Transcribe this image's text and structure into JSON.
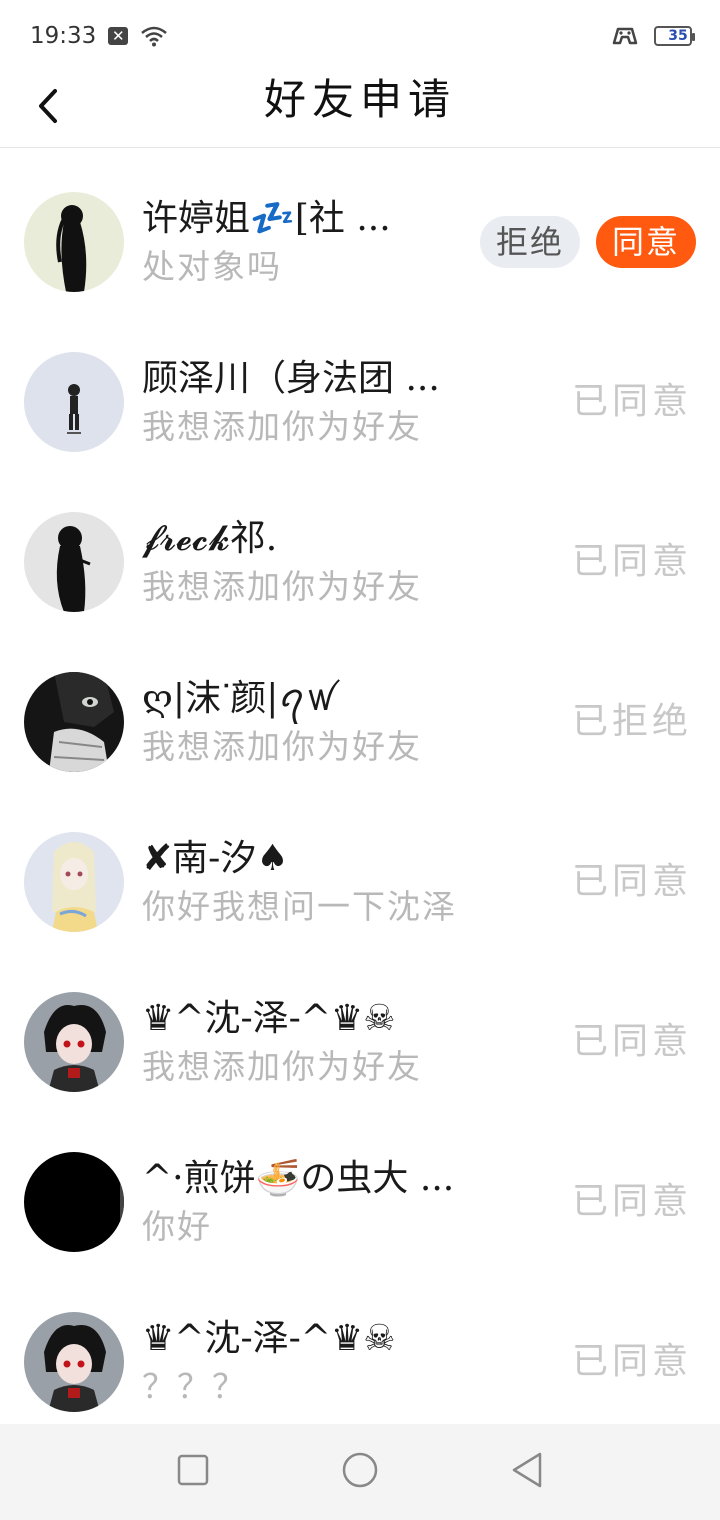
{
  "status_bar": {
    "time": "19:33",
    "battery": "35",
    "battery_level": 0.35,
    "icons": [
      "notification-icon",
      "wifi-icon",
      "game-icon",
      "battery-icon"
    ]
  },
  "header": {
    "title": "好友申请",
    "back_icon": "chevron-left-icon"
  },
  "requests": [
    {
      "name": "许婷姐💤[社 ...",
      "message": "处对象吗",
      "state": "pending",
      "reject_label": "拒绝",
      "accept_label": "同意",
      "avatar": "silhouette-girl"
    },
    {
      "name": "顾泽川（身法团 ...",
      "message": "我想添加你为好友",
      "state": "已同意",
      "avatar": "small-figure"
    },
    {
      "name": "𝓯𝓻𝓮𝓬𝓴祁.",
      "message": "我想添加你为好友",
      "state": "已同意",
      "avatar": "silhouette-dress"
    },
    {
      "name": "ღ|沫ᐝ颜|ꪖꪝ",
      "message": "我想添加你为好友",
      "state": "已拒绝",
      "avatar": "dark-anime"
    },
    {
      "name": "✘南-汐♠",
      "message": "你好我想问一下沈泽",
      "state": "已同意",
      "avatar": "blonde-anime"
    },
    {
      "name": "♛^沈-泽-^♛☠",
      "message": "我想添加你为好友",
      "state": "已同意",
      "avatar": "red-eye-anime"
    },
    {
      "name": "^·煎饼🍜の虫大 ...",
      "message": "你好",
      "state": "已同意",
      "avatar": "black"
    },
    {
      "name": "♛^沈-泽-^♛☠",
      "message": "？？？",
      "state": "已同意",
      "avatar": "red-eye-anime"
    }
  ],
  "nav_bar": {
    "icons": [
      "recent-apps-icon",
      "home-icon",
      "back-icon"
    ]
  },
  "colors": {
    "accept": "#ff5a10",
    "reject_bg": "#e9ecf1",
    "muted_text": "#b8b8b8",
    "status_text": "#c8c8c8"
  }
}
